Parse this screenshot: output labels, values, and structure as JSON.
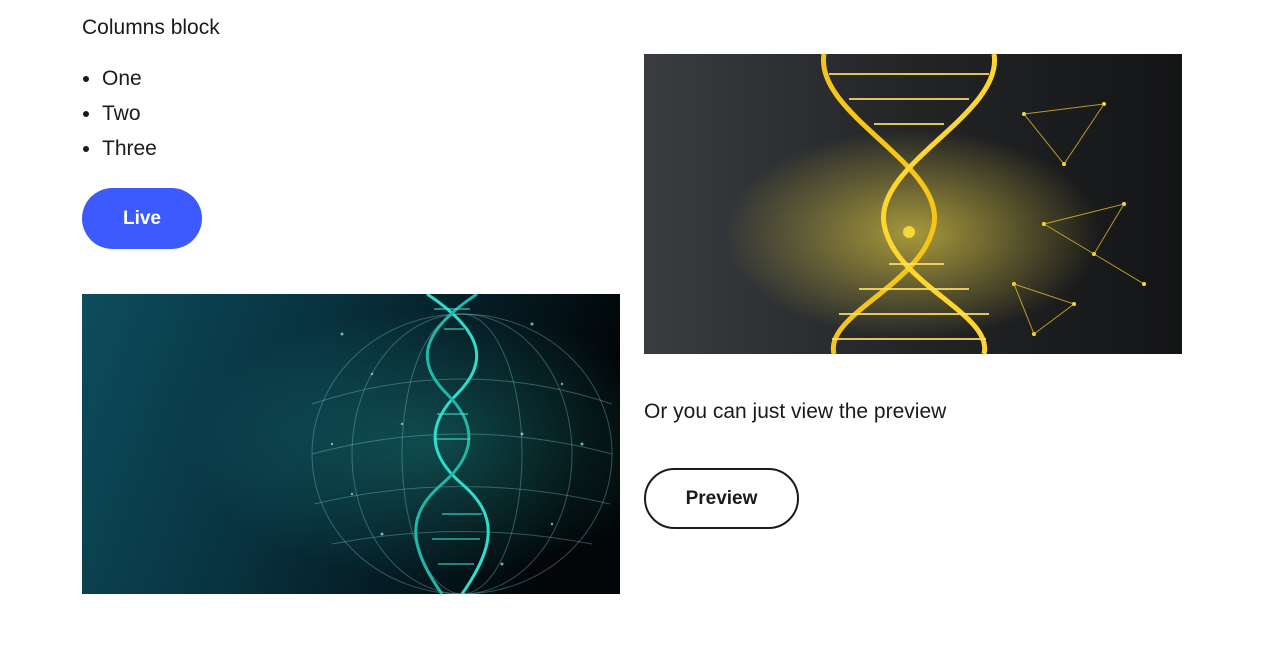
{
  "columns_block": {
    "heading": "Columns block",
    "list_items": [
      "One",
      "Two",
      "Three"
    ],
    "live_button_label": "Live",
    "left_image": {
      "subject": "teal dna helix on dark blue background"
    },
    "right_image": {
      "subject": "gold dna helix on dark background"
    },
    "caption": "Or you can just view the preview",
    "preview_button_label": "Preview"
  },
  "colors": {
    "primary_button": "#3d5afe",
    "text": "#1a1a1a",
    "background": "#ffffff"
  }
}
